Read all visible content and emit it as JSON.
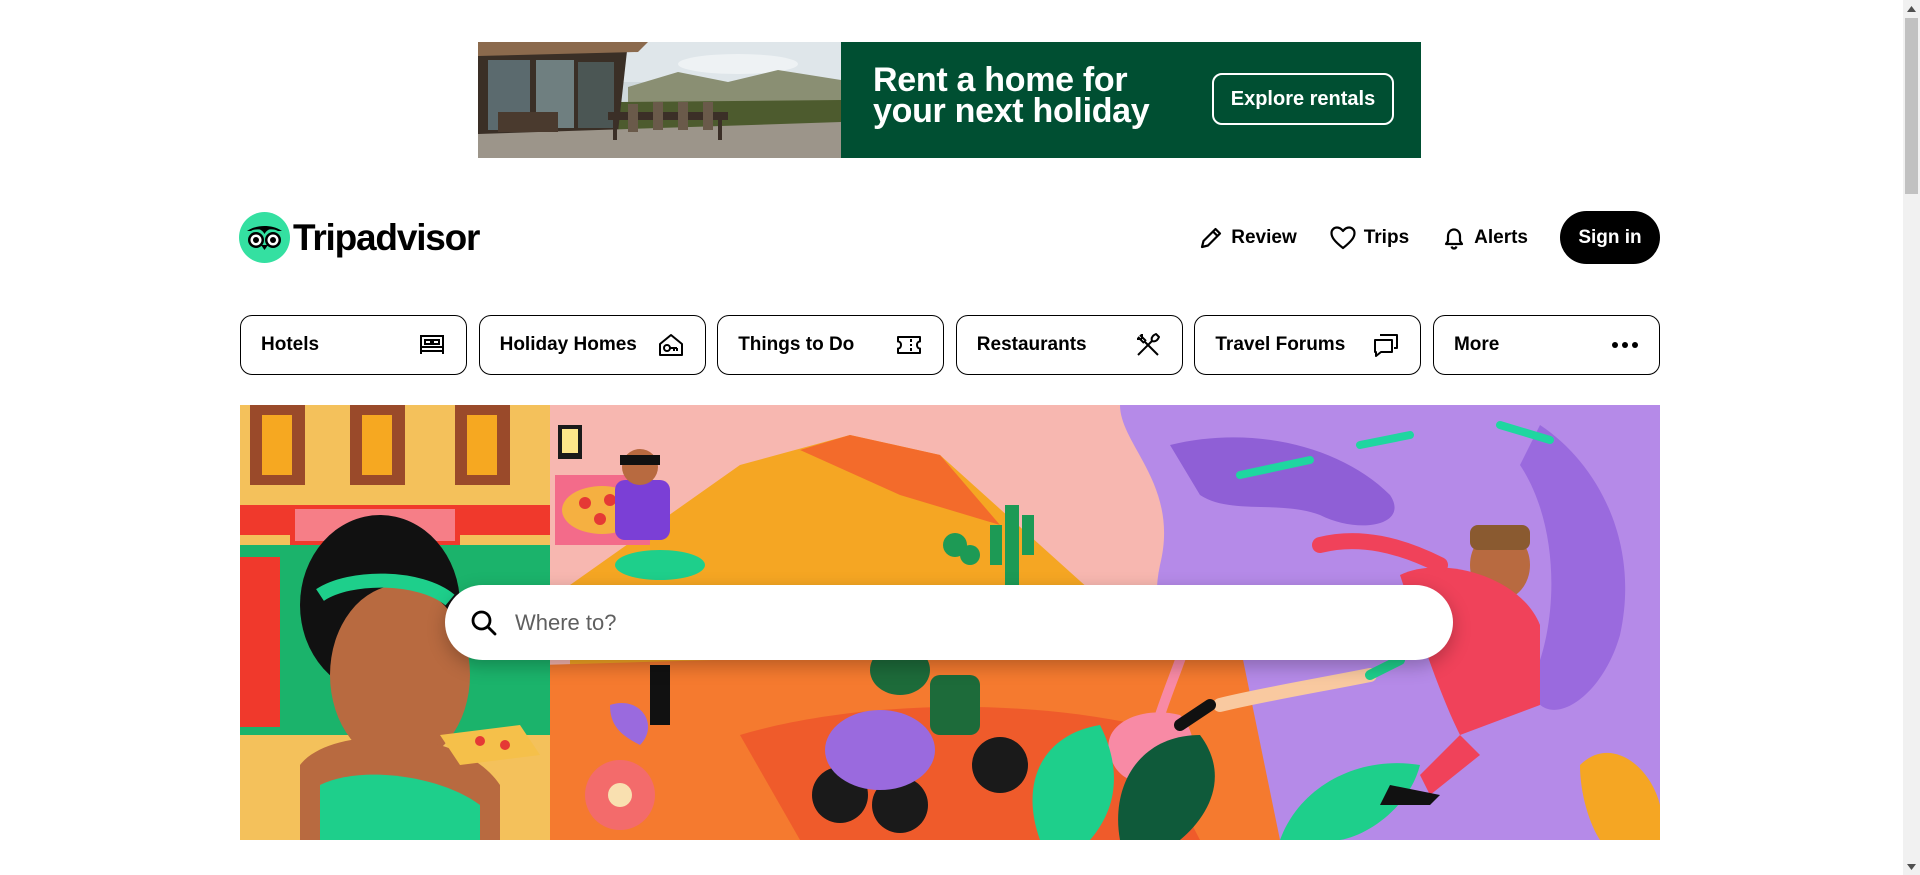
{
  "ad": {
    "headline_line1": "Rent a home for",
    "headline_line2": "your next holiday",
    "cta": "Explore rentals",
    "bg_color": "#004f32"
  },
  "header": {
    "logo_text": "Tripadvisor",
    "brand_color": "#34e0a1",
    "review_label": "Review",
    "trips_label": "Trips",
    "alerts_label": "Alerts",
    "sign_in_label": "Sign in"
  },
  "categories": [
    {
      "label": "Hotels",
      "icon": "bed-icon"
    },
    {
      "label": "Holiday Homes",
      "icon": "house-key-icon"
    },
    {
      "label": "Things to Do",
      "icon": "ticket-icon"
    },
    {
      "label": "Restaurants",
      "icon": "fork-knife-icon"
    },
    {
      "label": "Travel Forums",
      "icon": "chat-bubbles-icon"
    },
    {
      "label": "More",
      "icon": "ellipsis-icon"
    }
  ],
  "search": {
    "placeholder": "Where to?"
  }
}
